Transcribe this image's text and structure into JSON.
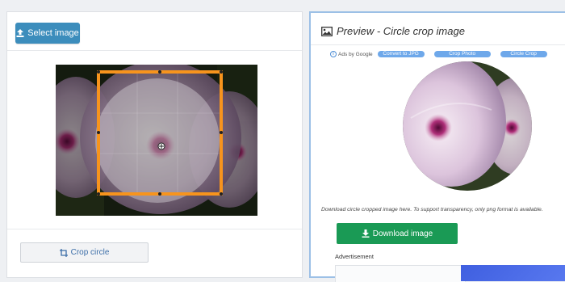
{
  "toolbar": {
    "select_label": "Select image",
    "crop_label": "Crop circle"
  },
  "preview": {
    "title": "Preview - Circle crop image",
    "ads_label": "Ads by Google",
    "ad_links": [
      "Convert to JPG",
      "Crop Photo",
      "Circle Crop"
    ],
    "note": "Download circle cropped image here. To support transparency, only png format is available.",
    "download_label": "Download image",
    "advertisement_label": "Advertisement"
  },
  "colors": {
    "select_button": "#3c8dbc",
    "crop_frame": "#f7941d",
    "download_button": "#1a9a55",
    "ad_chip": "#6ea8ea"
  },
  "icons": {
    "select": "upload-icon",
    "crop": "crop-icon",
    "preview": "image-icon",
    "download": "download-icon",
    "move_cursor": "move-cursor-icon"
  }
}
